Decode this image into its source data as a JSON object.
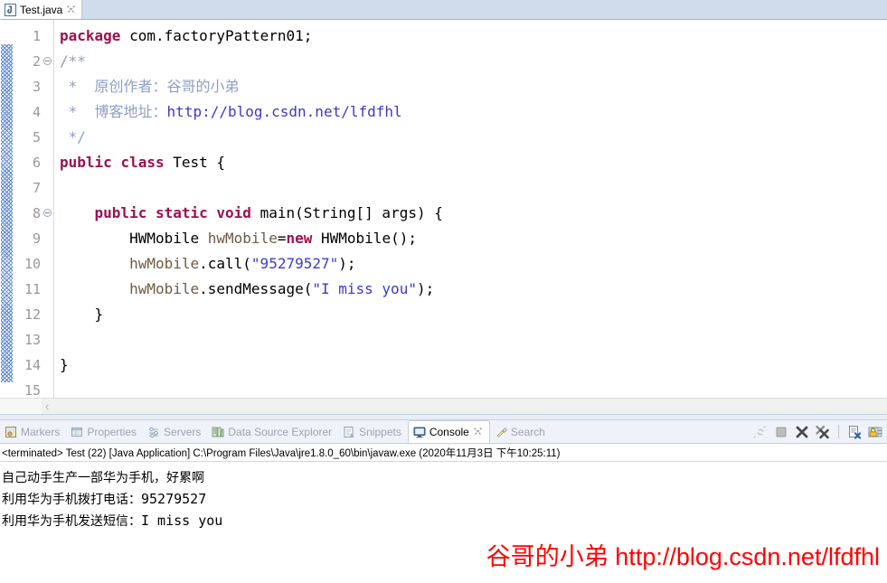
{
  "editor": {
    "tab": {
      "label": "Test.java",
      "file_icon": "java-file-icon",
      "close_icon": "close-icon"
    },
    "lines": [
      {
        "number": "1",
        "folding": false
      },
      {
        "number": "2",
        "folding": true
      },
      {
        "number": "3",
        "folding": false
      },
      {
        "number": "4",
        "folding": false
      },
      {
        "number": "5",
        "folding": false
      },
      {
        "number": "6",
        "folding": false
      },
      {
        "number": "7",
        "folding": false
      },
      {
        "number": "8",
        "folding": true
      },
      {
        "number": "9",
        "folding": false
      },
      {
        "number": "10",
        "folding": false
      },
      {
        "number": "11",
        "folding": false
      },
      {
        "number": "12",
        "folding": false
      },
      {
        "number": "13",
        "folding": false
      },
      {
        "number": "14",
        "folding": false
      },
      {
        "number": "15",
        "folding": false
      }
    ],
    "code": {
      "l1_kw": "package",
      "l1_rest": " com.factoryPattern01;",
      "l2": "/**",
      "l3": " *  原创作者：谷哥的小弟",
      "l4_prefix": " *  博客地址：",
      "l4_url": "http://blog.csdn.net/lfdfhl",
      "l5": " */",
      "l6_kw1": "public",
      "l6_kw2": "class",
      "l6_rest": " Test {",
      "l7": "",
      "l8_indent": "    ",
      "l8_kw1": "public",
      "l8_kw2": "static",
      "l8_kw3": "void",
      "l8_rest": " main(String[] args) {",
      "l9_indent": "        ",
      "l9_type": "HWMobile ",
      "l9_var": "hwMobile",
      "l9_eq": "=",
      "l9_kw": "new",
      "l9_rest": " HWMobile();",
      "l10_indent": "        ",
      "l10_var": "hwMobile",
      "l10_call": ".call(",
      "l10_str": "\"95279527\"",
      "l10_end": ");",
      "l11_indent": "        ",
      "l11_var": "hwMobile",
      "l11_call": ".sendMessage(",
      "l11_str": "\"I miss you\"",
      "l11_end": ");",
      "l12": "    }",
      "l13": "",
      "l14": "}",
      "l15": ""
    },
    "hscroll_left_arrow": "‹"
  },
  "view_stack": {
    "tabs": [
      {
        "label": "Markers",
        "icon": "markers-icon",
        "active": false,
        "closable": false
      },
      {
        "label": "Properties",
        "icon": "properties-icon",
        "active": false,
        "closable": false
      },
      {
        "label": "Servers",
        "icon": "servers-icon",
        "active": false,
        "closable": false
      },
      {
        "label": "Data Source Explorer",
        "icon": "database-icon",
        "active": false,
        "closable": false
      },
      {
        "label": "Snippets",
        "icon": "snippets-icon",
        "active": false,
        "closable": false
      },
      {
        "label": "Console",
        "icon": "console-icon",
        "active": true,
        "closable": true
      },
      {
        "label": "Search",
        "icon": "search-icon",
        "active": false,
        "closable": false
      }
    ],
    "actions": [
      {
        "name": "broken-link-icon",
        "enabled": false
      },
      {
        "name": "terminate-icon",
        "enabled": false
      },
      {
        "name": "remove-launch-icon",
        "enabled": true
      },
      {
        "name": "remove-all-launches-icon",
        "enabled": true
      },
      {
        "name": "clear-console-icon",
        "enabled": true
      },
      {
        "name": "pin-console-icon",
        "enabled": true
      }
    ]
  },
  "console": {
    "status": "<terminated> Test (22) [Java Application] C:\\Program Files\\Java\\jre1.8.0_60\\bin\\javaw.exe (2020年11月3日 下午10:25:11)",
    "output": [
      {
        "text": "自己动手生产一部华为手机，好累啊",
        "mono_tail": ""
      },
      {
        "text": "利用华为手机拨打电话：",
        "mono_tail": "95279527"
      },
      {
        "text": "利用华为手机发送短信：",
        "mono_tail": "I miss you"
      }
    ]
  },
  "watermark": {
    "text": "谷哥的小弟 http://blog.csdn.net/lfdfhl",
    "color": "#ff0000"
  }
}
